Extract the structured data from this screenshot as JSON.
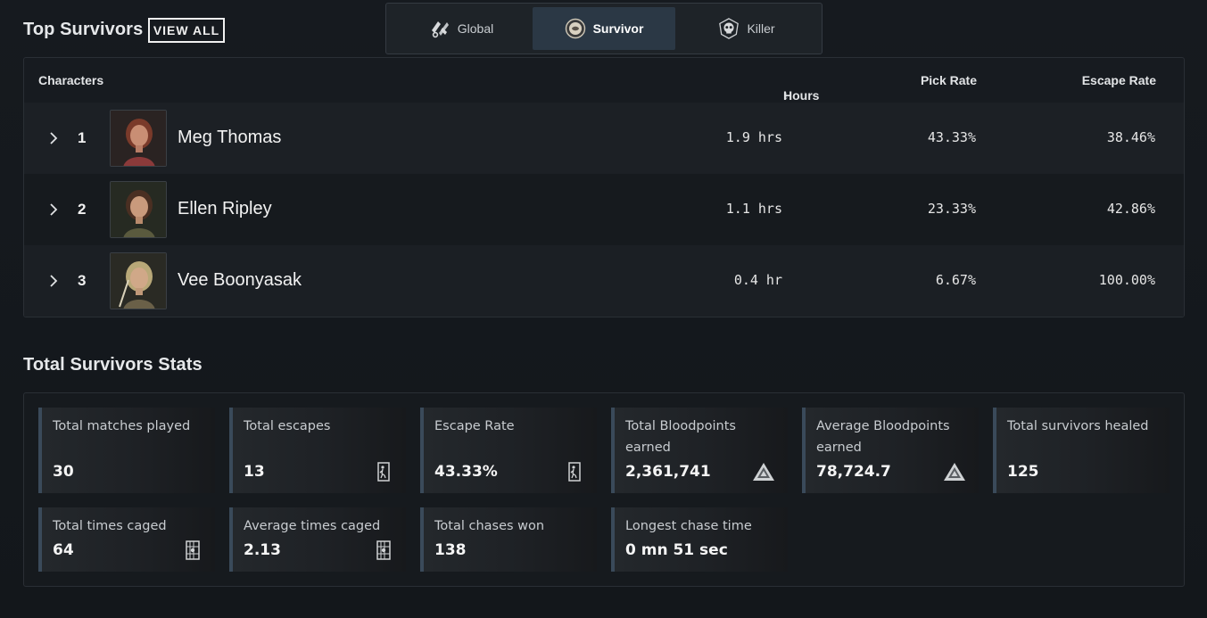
{
  "top_section": {
    "title": "Top Survivors",
    "view_all_label": "VIEW ALL"
  },
  "role_tabs": [
    {
      "label": "Global",
      "icon": "global-role-icon",
      "active": false
    },
    {
      "label": "Survivor",
      "icon": "survivor-role-icon",
      "active": true
    },
    {
      "label": "Killer",
      "icon": "killer-role-icon",
      "active": false
    }
  ],
  "table": {
    "columns": {
      "characters": "Characters",
      "hours": "Hours played",
      "pick_rate": "Pick Rate",
      "escape_rate": "Escape Rate"
    },
    "sort_icon": "arrow-down-icon",
    "rows": [
      {
        "rank": "1",
        "name": "Meg Thomas",
        "hours": "1.9 hrs",
        "pick_rate": "43.33%",
        "escape_rate": "38.46%"
      },
      {
        "rank": "2",
        "name": "Ellen Ripley",
        "hours": "1.1 hrs",
        "pick_rate": "23.33%",
        "escape_rate": "42.86%"
      },
      {
        "rank": "3",
        "name": "Vee Boonyasak",
        "hours": "0.4 hr",
        "pick_rate": "6.67%",
        "escape_rate": "100.00%"
      }
    ]
  },
  "stats_section": {
    "title": "Total Survivors Stats",
    "stats": [
      {
        "label": "Total matches played",
        "value": "30",
        "icon": ""
      },
      {
        "label": "Total escapes",
        "value": "13",
        "icon": "exit-door-icon"
      },
      {
        "label": "Escape Rate",
        "value": "43.33%",
        "icon": "exit-door-icon"
      },
      {
        "label": "Total Bloodpoints earned",
        "value": "2,361,741",
        "icon": "bloodpoints-icon"
      },
      {
        "label": "Average Bloodpoints earned",
        "value": "78,724.7",
        "icon": "bloodpoints-icon"
      },
      {
        "label": "Total survivors healed",
        "value": "125",
        "icon": ""
      },
      {
        "label": "Total times caged",
        "value": "64",
        "icon": "cage-icon"
      },
      {
        "label": "Average times caged",
        "value": "2.13",
        "icon": "cage-icon"
      },
      {
        "label": "Total chases won",
        "value": "138",
        "icon": ""
      },
      {
        "label": "Longest chase time",
        "value": "0 mn 51 sec",
        "icon": ""
      }
    ]
  },
  "colors": {
    "background": "#14181d",
    "active_tab": "#2b3845",
    "stat_accent": "#3a4a5a"
  }
}
